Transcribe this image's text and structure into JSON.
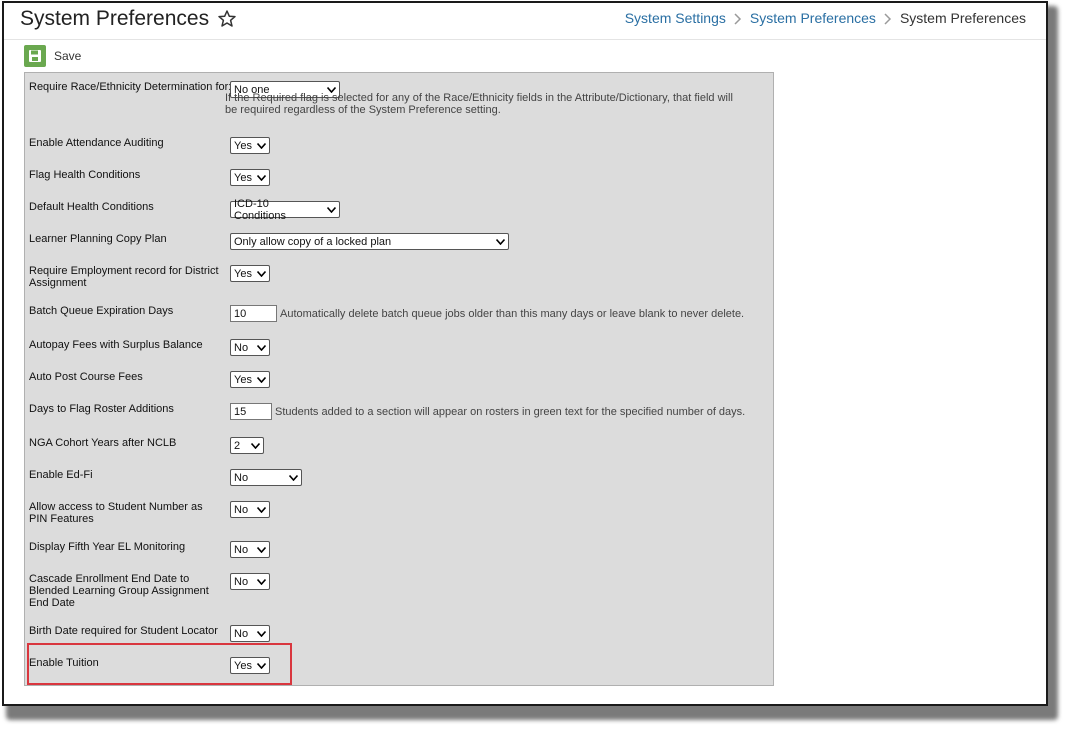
{
  "header": {
    "title": "System Preferences",
    "breadcrumb": [
      "System Settings",
      "System Preferences",
      "System Preferences"
    ]
  },
  "toolbar": {
    "save_label": "Save"
  },
  "fields": {
    "race": {
      "label": "Require Race/Ethnicity Determination for:",
      "value": "No one",
      "note": "If the Required flag is selected for any of the Race/Ethnicity fields in the Attribute/Dictionary, that field will be required regardless of the System Preference setting."
    },
    "attendance_auditing": {
      "label": "Enable Attendance Auditing",
      "value": "Yes"
    },
    "flag_health": {
      "label": "Flag Health Conditions",
      "value": "Yes"
    },
    "default_health": {
      "label": "Default Health Conditions",
      "value": "ICD-10 Conditions"
    },
    "learner_planning": {
      "label": "Learner Planning Copy Plan",
      "value": "Only allow copy of a locked plan"
    },
    "employment_record": {
      "label": "Require Employment record for District Assignment",
      "value": "Yes"
    },
    "batch_queue": {
      "label": "Batch Queue Expiration Days",
      "value": "10",
      "hint": "Automatically delete batch queue jobs older than this many days or leave blank to never delete."
    },
    "autopay": {
      "label": "Autopay Fees with Surplus Balance",
      "value": "No"
    },
    "auto_post": {
      "label": "Auto Post Course Fees",
      "value": "Yes"
    },
    "roster_days": {
      "label": "Days to Flag Roster Additions",
      "value": "15",
      "hint": "Students added to a section will appear on rosters in green text for the specified number of days."
    },
    "nga_cohort": {
      "label": "NGA Cohort Years after NCLB",
      "value": "2"
    },
    "ed_fi": {
      "label": "Enable Ed-Fi",
      "value": "No"
    },
    "student_pin": {
      "label": "Allow access to Student Number as PIN Features",
      "value": "No"
    },
    "fifth_year": {
      "label": "Display Fifth Year EL Monitoring",
      "value": "No"
    },
    "cascade": {
      "label": "Cascade Enrollment End Date to Blended Learning Group Assignment End Date",
      "value": "No"
    },
    "birth_date": {
      "label": "Birth Date required for Student Locator",
      "value": "No"
    },
    "tuition": {
      "label": "Enable Tuition",
      "value": "Yes"
    }
  },
  "colors": {
    "link": "#2a6fa3",
    "save_green": "#6aa84f",
    "panel_bg": "#dcdcdc",
    "highlight": "#d9363e"
  },
  "icons": {
    "star": "star-outline-icon",
    "save": "floppy-disk-icon",
    "chevron": "chevron-down-icon",
    "separator": "chevron-right-icon"
  }
}
